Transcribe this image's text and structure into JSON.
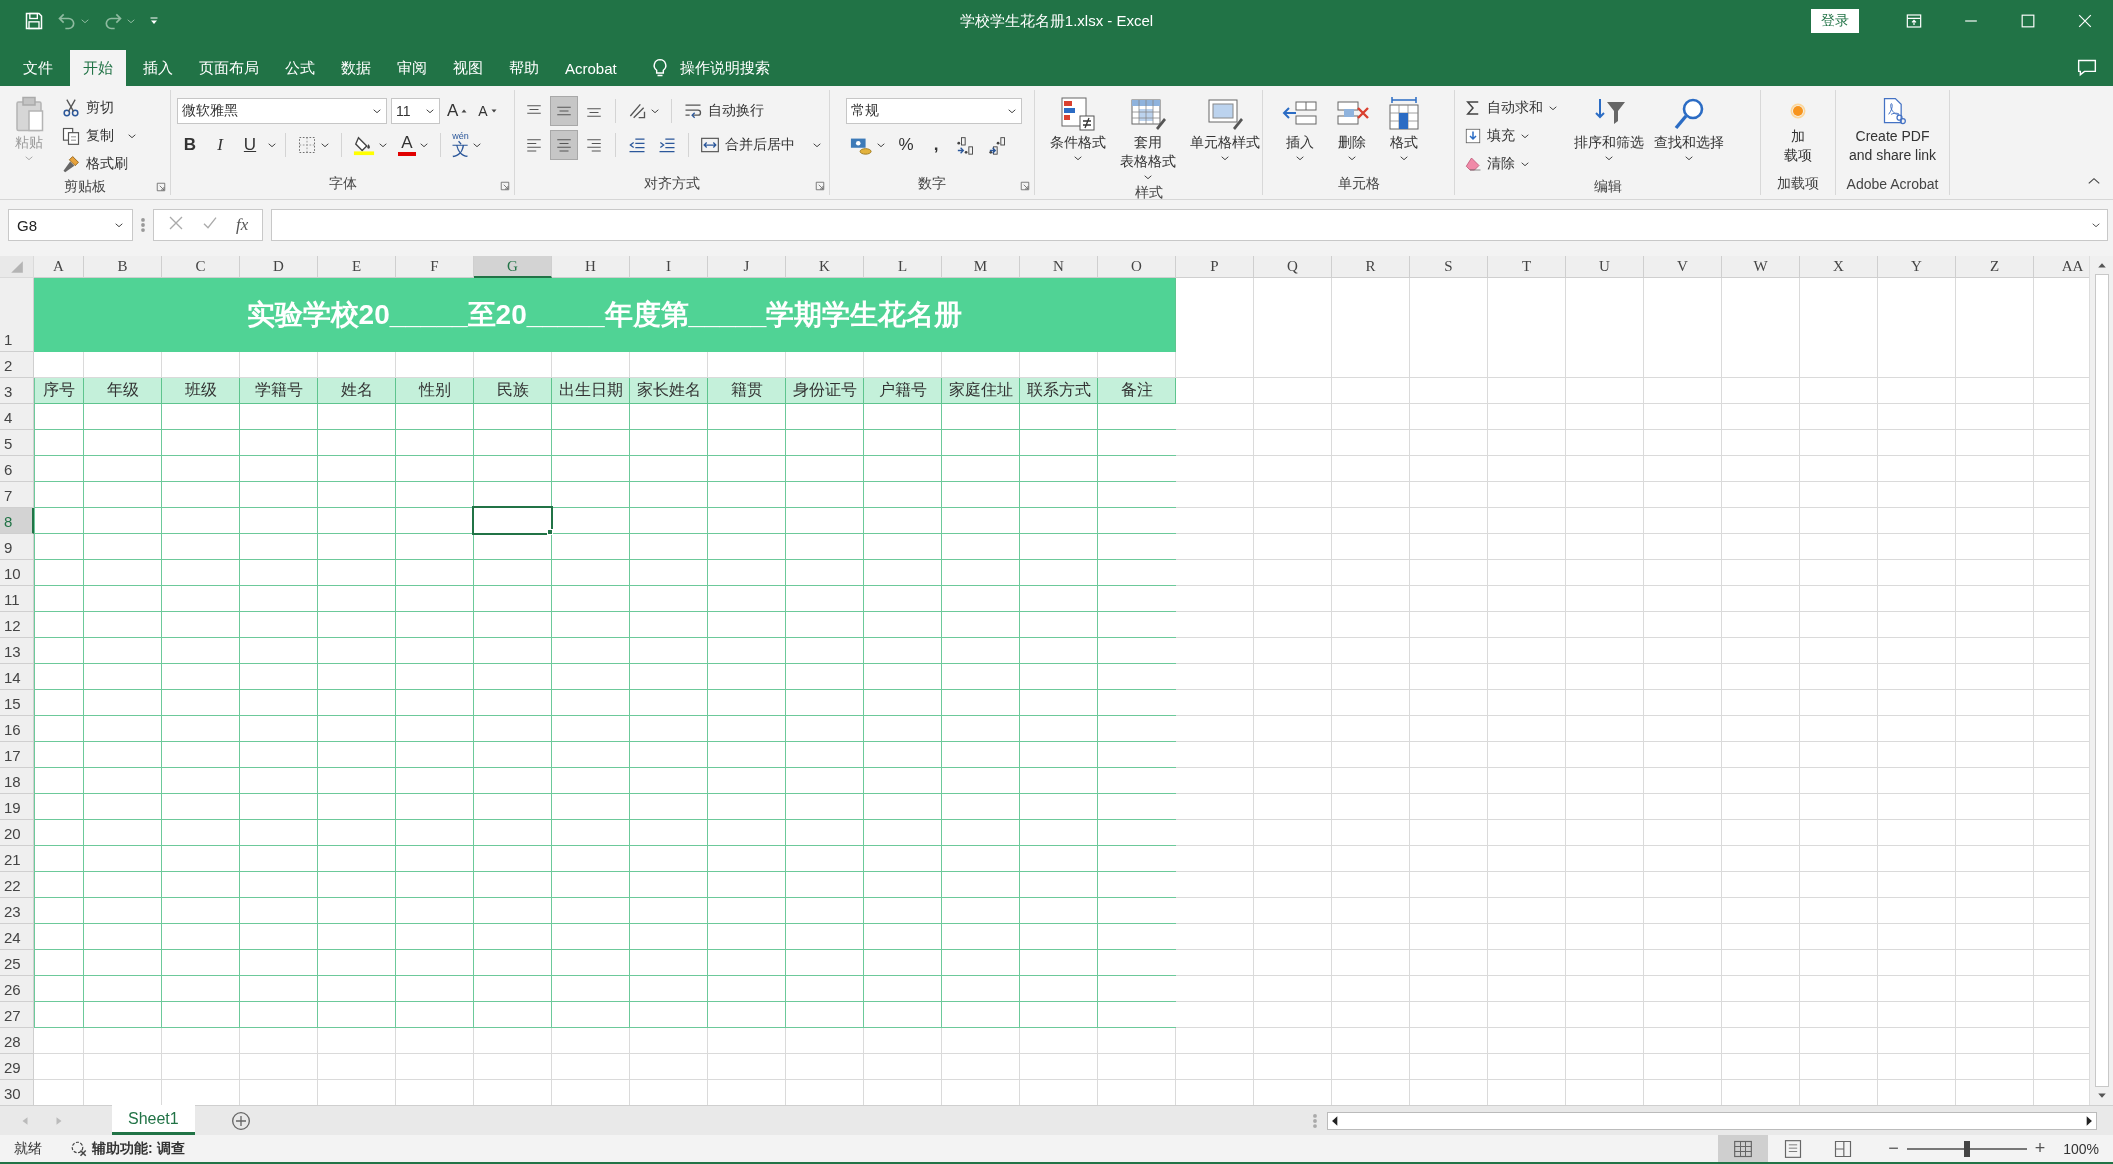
{
  "window": {
    "title": "学校学生花名册1.xlsx  -  Excel",
    "sign_in": "登录"
  },
  "menu_tabs": [
    {
      "label": "文件",
      "selected": false
    },
    {
      "label": "开始",
      "selected": true
    },
    {
      "label": "插入",
      "selected": false
    },
    {
      "label": "页面布局",
      "selected": false
    },
    {
      "label": "公式",
      "selected": false
    },
    {
      "label": "数据",
      "selected": false
    },
    {
      "label": "审阅",
      "selected": false
    },
    {
      "label": "视图",
      "selected": false
    },
    {
      "label": "帮助",
      "selected": false
    },
    {
      "label": "Acrobat",
      "selected": false
    }
  ],
  "tell_me": "操作说明搜索",
  "ribbon": {
    "clipboard": {
      "label": "剪贴板",
      "paste": {
        "label": "粘贴",
        "disabled": true
      },
      "commands": [
        {
          "kind": "cut",
          "label": "剪切"
        },
        {
          "kind": "copy",
          "label": "复制"
        },
        {
          "kind": "format_painter",
          "label": "格式刷"
        }
      ]
    },
    "font": {
      "label": "字体",
      "font_name": "微软雅黑",
      "font_size": "11",
      "size_buttons": [
        "A",
        "A"
      ],
      "style_buttons": [
        {
          "kind": "bold",
          "label": "B"
        },
        {
          "kind": "italic",
          "label": "I"
        },
        {
          "kind": "underline",
          "label": "U"
        }
      ],
      "font_color": "A",
      "phonetic": {
        "top": "wén",
        "bottom": "文"
      }
    },
    "alignment": {
      "label": "对齐方式",
      "vertical": [
        {
          "kind": "top",
          "selected": false
        },
        {
          "kind": "middle",
          "selected": true
        },
        {
          "kind": "bottom",
          "selected": false
        }
      ],
      "horizontal": [
        {
          "kind": "left",
          "selected": false
        },
        {
          "kind": "center",
          "selected": true
        },
        {
          "kind": "right",
          "selected": false
        }
      ],
      "wrap_text": "自动换行",
      "merge_center": "合并后居中"
    },
    "number": {
      "label": "数字",
      "format": "常规",
      "percent": "%",
      "comma": ","
    },
    "styles": {
      "label": "样式",
      "buttons": [
        {
          "kind": "conditional",
          "lines": [
            "条件格式"
          ]
        },
        {
          "kind": "table",
          "lines": [
            "套用",
            "表格格式"
          ]
        },
        {
          "kind": "cell_styles",
          "lines": [
            "单元格样式"
          ]
        }
      ]
    },
    "cells": {
      "label": "单元格",
      "buttons": [
        {
          "kind": "insert",
          "lines": [
            "插入"
          ]
        },
        {
          "kind": "delete",
          "lines": [
            "删除"
          ]
        },
        {
          "kind": "format",
          "lines": [
            "格式"
          ]
        }
      ]
    },
    "editing": {
      "label": "编辑",
      "commands": [
        {
          "kind": "autosum",
          "label": "自动求和"
        },
        {
          "kind": "fill",
          "label": "填充"
        },
        {
          "kind": "clear",
          "label": "清除"
        }
      ],
      "buttons": [
        {
          "kind": "sort",
          "lines": [
            "排序和筛选"
          ]
        },
        {
          "kind": "find",
          "lines": [
            "查找和选择"
          ]
        }
      ]
    },
    "addins": {
      "label": "加载项",
      "lines": [
        "加",
        "载项"
      ]
    },
    "acrobat": {
      "label": "Adobe Acrobat",
      "lines": [
        "Create PDF",
        "and share link"
      ]
    }
  },
  "formula_bar": {
    "name_box": "G8",
    "fx": "fx"
  },
  "sheet": {
    "title": "实验学校20_____至20_____年度第_____学期学生花名册",
    "headers": [
      "序号",
      "年级",
      "班级",
      "学籍号",
      "姓名",
      "性别",
      "民族",
      "出生日期",
      "家长姓名",
      "籍贯",
      "身份证号",
      "户籍号",
      "家庭住址",
      "联系方式",
      "备注"
    ],
    "columns": [
      {
        "label": "A",
        "selected": false
      },
      {
        "label": "B",
        "selected": false
      },
      {
        "label": "C",
        "selected": false
      },
      {
        "label": "D",
        "selected": false
      },
      {
        "label": "E",
        "selected": false
      },
      {
        "label": "F",
        "selected": false
      },
      {
        "label": "G",
        "selected": true
      },
      {
        "label": "H",
        "selected": false
      },
      {
        "label": "I",
        "selected": false
      },
      {
        "label": "J",
        "selected": false
      },
      {
        "label": "K",
        "selected": false
      },
      {
        "label": "L",
        "selected": false
      },
      {
        "label": "M",
        "selected": false
      },
      {
        "label": "N",
        "selected": false
      },
      {
        "label": "O",
        "selected": false
      },
      {
        "label": "P",
        "selected": false
      },
      {
        "label": "Q",
        "selected": false
      },
      {
        "label": "R",
        "selected": false
      },
      {
        "label": "S",
        "selected": false
      },
      {
        "label": "T",
        "selected": false
      },
      {
        "label": "U",
        "selected": false
      },
      {
        "label": "V",
        "selected": false
      },
      {
        "label": "W",
        "selected": false
      },
      {
        "label": "X",
        "selected": false
      },
      {
        "label": "Y",
        "selected": false
      },
      {
        "label": "Z",
        "selected": false
      },
      {
        "label": "AA",
        "selected": false
      }
    ],
    "rows": [
      {
        "label": "1",
        "kind": "title",
        "selected": false
      },
      {
        "label": "2",
        "kind": "blank",
        "selected": false
      },
      {
        "label": "3",
        "kind": "header",
        "selected": false
      },
      {
        "label": "4",
        "kind": "table",
        "selected": false
      },
      {
        "label": "5",
        "kind": "table",
        "selected": false
      },
      {
        "label": "6",
        "kind": "table",
        "selected": false
      },
      {
        "label": "7",
        "kind": "table",
        "selected": false
      },
      {
        "label": "8",
        "kind": "table",
        "selected": true
      },
      {
        "label": "9",
        "kind": "table",
        "selected": false
      },
      {
        "label": "10",
        "kind": "table",
        "selected": false
      },
      {
        "label": "11",
        "kind": "table",
        "selected": false
      },
      {
        "label": "12",
        "kind": "table",
        "selected": false
      },
      {
        "label": "13",
        "kind": "table",
        "selected": false
      },
      {
        "label": "14",
        "kind": "table",
        "selected": false
      },
      {
        "label": "15",
        "kind": "table",
        "selected": false
      },
      {
        "label": "16",
        "kind": "table",
        "selected": false
      },
      {
        "label": "17",
        "kind": "table",
        "selected": false
      },
      {
        "label": "18",
        "kind": "table",
        "selected": false
      },
      {
        "label": "19",
        "kind": "table",
        "selected": false
      },
      {
        "label": "20",
        "kind": "table",
        "selected": false
      },
      {
        "label": "21",
        "kind": "table",
        "selected": false
      },
      {
        "label": "22",
        "kind": "table",
        "selected": false
      },
      {
        "label": "23",
        "kind": "table",
        "selected": false
      },
      {
        "label": "24",
        "kind": "table",
        "selected": false
      },
      {
        "label": "25",
        "kind": "table",
        "selected": false
      },
      {
        "label": "26",
        "kind": "table",
        "selected": false
      },
      {
        "label": "27",
        "kind": "table",
        "selected": false
      },
      {
        "label": "28",
        "kind": "blank",
        "selected": false
      },
      {
        "label": "29",
        "kind": "blank",
        "selected": false
      },
      {
        "label": "30",
        "kind": "blank",
        "selected": false
      }
    ]
  },
  "sheet_tabs": [
    {
      "label": "Sheet1",
      "selected": true
    }
  ],
  "status_bar": {
    "ready": "就绪",
    "accessibility": "辅助功能: 调查",
    "views": [
      {
        "kind": "normal",
        "selected": true
      },
      {
        "kind": "page_layout",
        "selected": false
      },
      {
        "kind": "page_break",
        "selected": false
      }
    ],
    "zoom": {
      "minus": "−",
      "plus": "+",
      "level": 0.5,
      "reading": "100%"
    }
  }
}
